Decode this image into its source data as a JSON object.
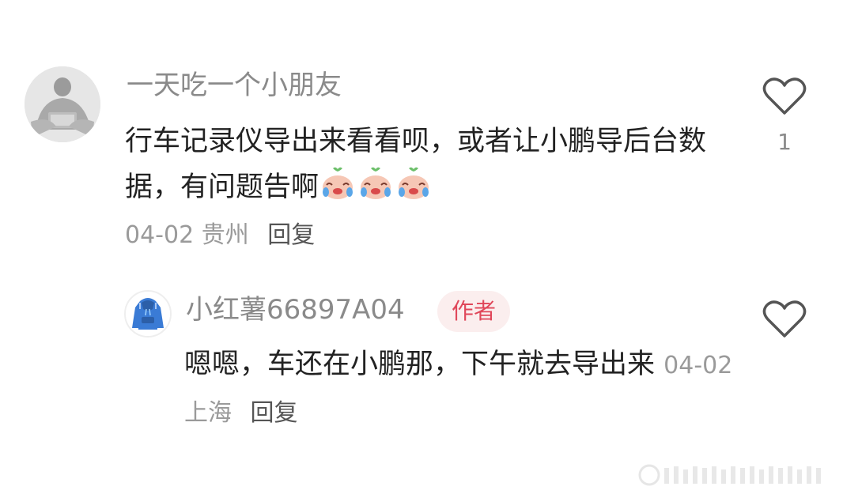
{
  "comments": [
    {
      "username": "一天吃一个小朋友",
      "content": "行车记录仪导出来看看呗，或者让小鹏导后台数据，有问题告啊",
      "emoji_icons": [
        "crying-laughing-peach-emoji",
        "crying-laughing-peach-emoji",
        "crying-laughing-peach-emoji"
      ],
      "date": "04-02",
      "location": "贵州",
      "reply_label": "回复",
      "like_count": "1"
    }
  ],
  "reply": {
    "username": "小红薯66897A04",
    "badge": "作者",
    "content": "嗯嗯，车还在小鹏那，下午就去导出来",
    "date": "04-02",
    "location": "上海",
    "reply_label": "回复"
  },
  "colors": {
    "badge_bg": "#fbeeee",
    "badge_text": "#e0475a",
    "muted": "#9a9a9a",
    "text": "#222222"
  }
}
